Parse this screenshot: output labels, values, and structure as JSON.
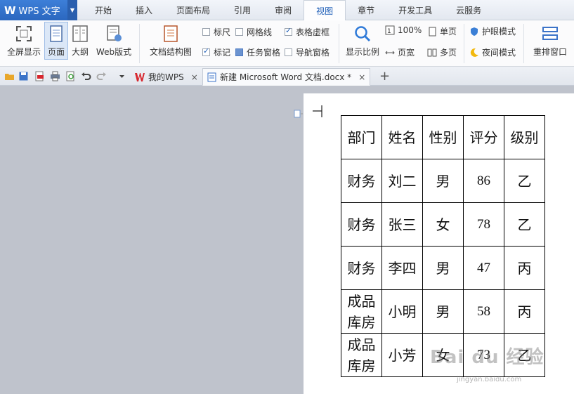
{
  "app": {
    "name": "WPS 文字"
  },
  "menu": {
    "tabs": [
      "开始",
      "插入",
      "页面布局",
      "引用",
      "审阅",
      "视图",
      "章节",
      "开发工具",
      "云服务"
    ],
    "active": "视图"
  },
  "ribbon": {
    "fullscreen": "全屏显示",
    "page": "页面",
    "outline": "大纲",
    "web": "Web版式",
    "docmap": "文档结构图",
    "ruler": "标尺",
    "gridlines": "网格线",
    "table_dashed": "表格虚框",
    "marks": "标记",
    "task_pane": "任务窗格",
    "nav_pane": "导航窗格",
    "zoom": "显示比例",
    "zoom100": "100%",
    "page_width": "页宽",
    "single_page": "单页",
    "multi_page": "多页",
    "eye_mode": "护眼模式",
    "night_mode": "夜间模式",
    "rearrange": "重排窗口"
  },
  "tabs": {
    "mywps": "我的WPS",
    "doc": "新建 Microsoft Word 文档.docx *"
  },
  "table": {
    "header": [
      "部门",
      "姓名",
      "性别",
      "评分",
      "级别"
    ],
    "rows": [
      [
        "财务",
        "刘二",
        "男",
        "86",
        "乙"
      ],
      [
        "财务",
        "张三",
        "女",
        "78",
        "乙"
      ],
      [
        "财务",
        "李四",
        "男",
        "47",
        "丙"
      ],
      [
        "成品库房",
        "小明",
        "男",
        "58",
        "丙"
      ],
      [
        "成品库房",
        "小芳",
        "女",
        "73",
        "乙"
      ]
    ]
  },
  "watermark": {
    "text": "Bai du 经验",
    "sub": "jingyan.baidu.com"
  },
  "colors": {
    "accent": "#2b67bf",
    "wps_red": "#d7262e"
  }
}
